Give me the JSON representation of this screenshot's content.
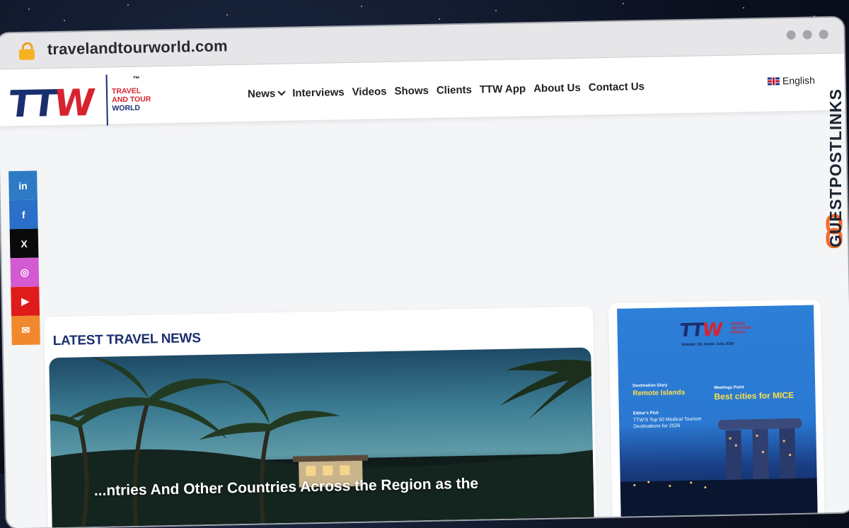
{
  "browser": {
    "url": "travelandtourworld.com"
  },
  "site": {
    "logo_mark": "TTW",
    "logo_lines": [
      "TRAVEL",
      "AND TOUR",
      "WORLD"
    ],
    "logo_tm": "™",
    "nav": [
      {
        "label": "News"
      },
      {
        "label": "Interviews"
      },
      {
        "label": "Videos"
      },
      {
        "label": "Shows"
      },
      {
        "label": "Clients"
      },
      {
        "label": "TTW App"
      },
      {
        "label": "About Us"
      },
      {
        "label": "Contact Us"
      }
    ],
    "language": "English"
  },
  "social": [
    {
      "icon": "linkedin-icon",
      "glyph": "in",
      "color": "#2d7bc4"
    },
    {
      "icon": "facebook-icon",
      "glyph": "f",
      "color": "#2a6fc9"
    },
    {
      "icon": "x-icon",
      "glyph": "X",
      "color": "#0a0a0a"
    },
    {
      "icon": "instagram-icon",
      "glyph": "◎",
      "color": "#d45ad1"
    },
    {
      "icon": "youtube-icon",
      "glyph": "▶",
      "color": "#e01b1b"
    },
    {
      "icon": "email-icon",
      "glyph": "✉",
      "color": "#f0892d"
    }
  ],
  "news": {
    "section_title": "LATEST TRAVEL NEWS",
    "headline_visible": "...ntries And Other Countries Across the Region as the"
  },
  "magazine": {
    "logo_mark": "TTW",
    "volume": "Volume: 03, Issue: July 2026",
    "items": [
      {
        "label": "Destination Diary",
        "headline": "Remote Islands"
      },
      {
        "label": "Meetings Point",
        "headline": "Best cities for MICE"
      },
      {
        "label": "Editor's Pick",
        "headline": "TTW'S Top 50 Medical Tourism Destinations for 2026"
      }
    ]
  },
  "watermark": "GUESTPOSTLINKS",
  "colors": {
    "brand_navy": "#1a2f6e",
    "brand_red": "#d7232f",
    "accent_orange": "#f26a2e"
  }
}
